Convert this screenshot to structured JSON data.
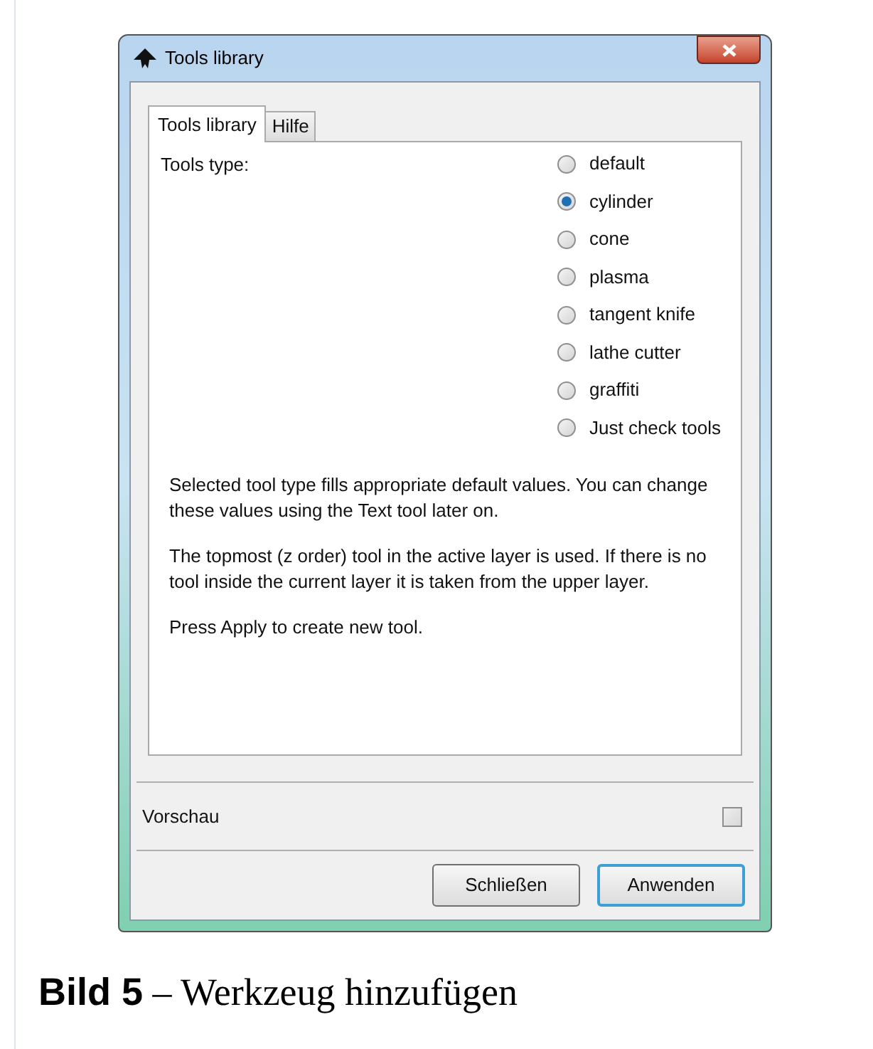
{
  "window": {
    "title": "Tools library"
  },
  "tabs": [
    {
      "label": "Tools library",
      "selected": true
    },
    {
      "label": "Hilfe",
      "selected": false
    }
  ],
  "tools_type": {
    "label": "Tools type:",
    "options": [
      {
        "label": "default",
        "selected": false
      },
      {
        "label": "cylinder",
        "selected": true
      },
      {
        "label": "cone",
        "selected": false
      },
      {
        "label": "plasma",
        "selected": false
      },
      {
        "label": "tangent knife",
        "selected": false
      },
      {
        "label": "lathe cutter",
        "selected": false
      },
      {
        "label": "graffiti",
        "selected": false
      },
      {
        "label": "Just check tools",
        "selected": false
      }
    ]
  },
  "help_paragraphs": [
    "Selected tool type fills appropriate default values. You can change these values using the Text tool later on.",
    "The topmost (z order) tool in the active layer is used. If there is no tool inside the current layer it is taken from the upper layer.",
    "Press Apply to create new tool."
  ],
  "preview": {
    "label": "Vorschau",
    "checked": false
  },
  "buttons": [
    {
      "label": "Schließen",
      "default": false
    },
    {
      "label": "Anwenden",
      "default": true
    }
  ],
  "caption": "**Bild 5** – Werkzeug hinzufügen"
}
